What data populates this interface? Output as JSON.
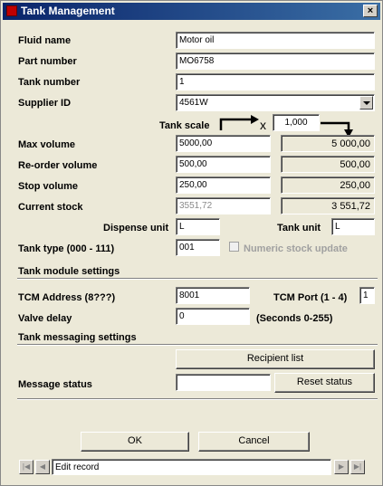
{
  "window": {
    "title": "Tank Management",
    "close_glyph": "×"
  },
  "fields": {
    "fluid_name": {
      "label": "Fluid name",
      "value": "Motor oil"
    },
    "part_number": {
      "label": "Part number",
      "value": "MO6758"
    },
    "tank_number": {
      "label": "Tank number",
      "value": "1"
    },
    "supplier_id": {
      "label": "Supplier ID",
      "value": "4561W"
    },
    "tank_scale": {
      "label": "Tank scale",
      "x_symbol": "x",
      "value": "1,000"
    },
    "max_volume": {
      "label": "Max volume",
      "value": "5000,00",
      "scaled": "5 000,00"
    },
    "reorder_volume": {
      "label": "Re-order volume",
      "value": "500,00",
      "scaled": "500,00"
    },
    "stop_volume": {
      "label": "Stop volume",
      "value": "250,00",
      "scaled": "250,00"
    },
    "current_stock": {
      "label": "Current stock",
      "value": "3551,72",
      "scaled": "3 551,72"
    },
    "dispense_unit": {
      "label": "Dispense unit",
      "value": "L"
    },
    "tank_unit": {
      "label": "Tank unit",
      "value": "L"
    },
    "tank_type": {
      "label": "Tank type (000 - 111)",
      "value": "001"
    },
    "numeric_stock_update": {
      "label": "Numeric stock update",
      "checked": false
    }
  },
  "tank_module": {
    "heading": "Tank module settings",
    "tcm_address": {
      "label": "TCM Address (8???)",
      "value": "8001"
    },
    "tcm_port": {
      "label": "TCM Port (1 - 4)",
      "value": "1"
    },
    "valve_delay": {
      "label": "Valve delay",
      "value": "0",
      "hint": "(Seconds 0-255)"
    }
  },
  "messaging": {
    "heading": "Tank messaging settings",
    "recipient_list_button": "Recipient list",
    "message_status": {
      "label": "Message status",
      "value": ""
    },
    "reset_status_button": "Reset status"
  },
  "footer": {
    "ok_button": "OK",
    "cancel_button": "Cancel",
    "record_status": "Edit record",
    "nav_first": "|◀",
    "nav_prev": "◀",
    "nav_next": "▶",
    "nav_last": "▶|"
  }
}
